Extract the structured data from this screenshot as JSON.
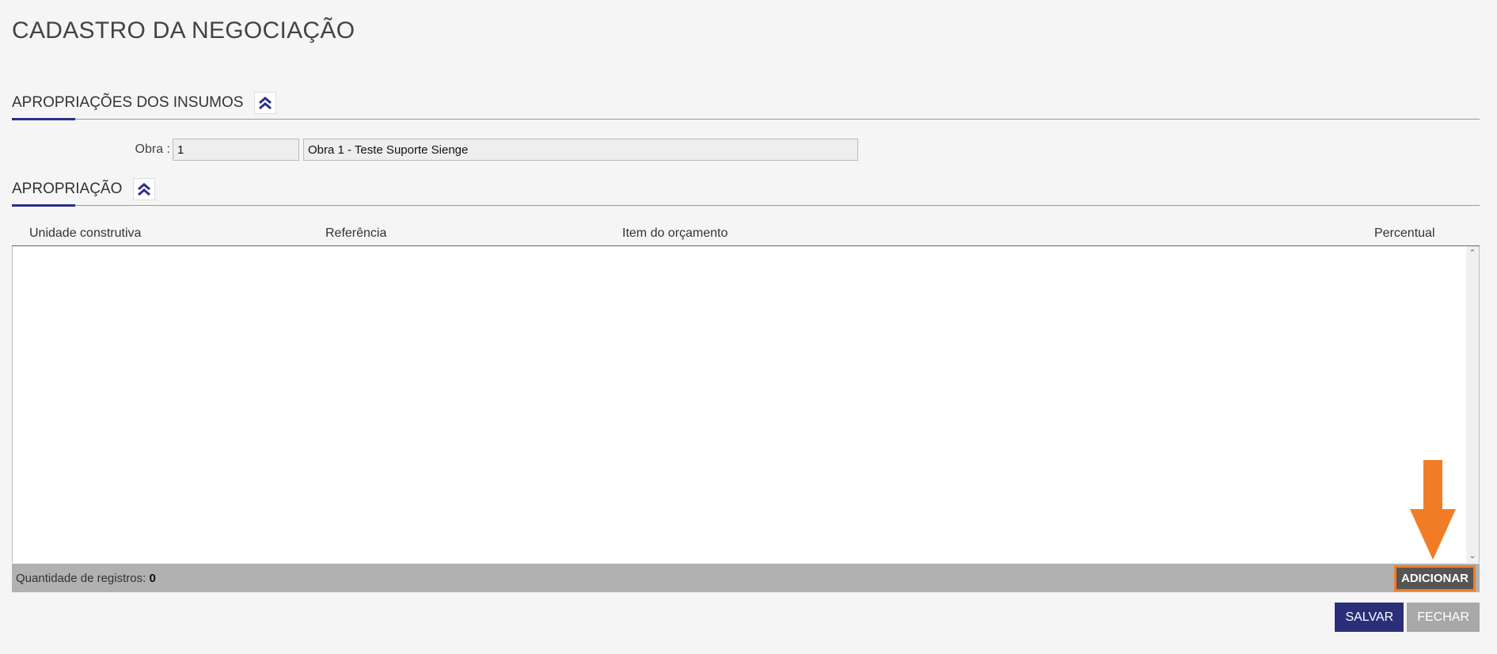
{
  "page": {
    "title": "CADASTRO DA NEGOCIAÇÃO"
  },
  "insumos_section": {
    "title": "APROPRIAÇÕES DOS INSUMOS"
  },
  "obra": {
    "label": "Obra :",
    "code": "1",
    "name": "Obra 1 - Teste Suporte Sienge"
  },
  "apropriacao_section": {
    "title": "APROPRIAÇÃO"
  },
  "grid": {
    "columns": [
      "Unidade construtiva",
      "Referência",
      "Item do orçamento",
      "Percentual"
    ],
    "rows": [],
    "footer_label": "Quantidade de registros:",
    "record_count": "0",
    "add_label": "ADICIONAR"
  },
  "actions": {
    "save_label": "SALVAR",
    "close_label": "FECHAR"
  },
  "colors": {
    "accent": "#2b2f8a",
    "highlight": "#f07d26",
    "save": "#2b2f7a"
  },
  "icons": {
    "collapse": "double-chevron-up-icon",
    "annotation": "down-arrow-icon"
  }
}
